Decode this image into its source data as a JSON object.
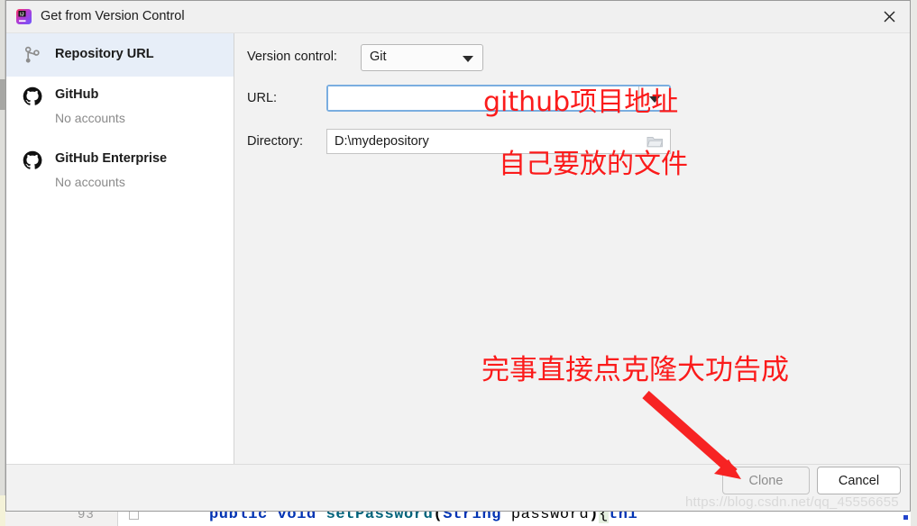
{
  "window": {
    "title": "Get from Version Control",
    "app_icon": "intellij-idea-icon",
    "close_label": "✕"
  },
  "sidebar": {
    "items": [
      {
        "label": "Repository URL",
        "sub": "",
        "icon": "branch-icon",
        "selected": true
      },
      {
        "label": "GitHub",
        "sub": "No accounts",
        "icon": "github-icon",
        "selected": false
      },
      {
        "label": "GitHub Enterprise",
        "sub": "No accounts",
        "icon": "github-icon",
        "selected": false
      }
    ]
  },
  "form": {
    "version_control": {
      "label": "Version control:",
      "value": "Git",
      "options": [
        "Git"
      ]
    },
    "url": {
      "label": "URL:",
      "value": "",
      "placeholder": ""
    },
    "directory": {
      "label": "Directory:",
      "value": "D:\\mydepository",
      "browse_icon": "folder-icon"
    }
  },
  "footer": {
    "clone_label": "Clone",
    "cancel_label": "Cancel"
  },
  "annotations": {
    "url_note": "github项目地址",
    "directory_note": "自己要放的文件",
    "clone_note": "完事直接点克隆大功告成",
    "color": "#fb1b1b"
  },
  "watermark": {
    "text": "https://blog.csdn.net/qq_45556655"
  },
  "background_editor": {
    "line_number": "93",
    "code_keyword1": "public void",
    "code_method": " setPassword",
    "code_paren_open": "(",
    "code_keyword2": "String",
    "code_param": " password",
    "code_paren_close": ")",
    "code_brace": "{",
    "code_this": "thi"
  },
  "colors": {
    "dialog_bg": "#f2f2f2",
    "sidebar_bg": "#ffffff",
    "selected_item_bg": "#e7eef8",
    "focus_border": "#7aaee0",
    "annotation_red": "#fb1b1b",
    "code_keyword": "#0033b3",
    "code_method": "#00627a"
  }
}
